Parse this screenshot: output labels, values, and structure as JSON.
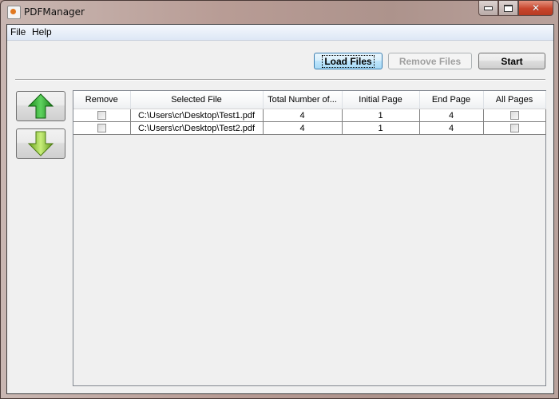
{
  "window": {
    "title": "PDFManager",
    "controls": {
      "minimize": "minimize-icon",
      "maximize": "maximize-icon",
      "close": "close-icon"
    }
  },
  "menubar": {
    "items": [
      {
        "label": "File"
      },
      {
        "label": "Help"
      }
    ]
  },
  "toolbar": {
    "load_label": "Load Files",
    "remove_label": "Remove Files",
    "start_label": "Start"
  },
  "side_buttons": {
    "up": "arrow-up-icon",
    "down": "arrow-down-icon"
  },
  "table": {
    "columns": [
      "Remove",
      "Selected File",
      "Total Number of...",
      "Initial Page",
      "End Page",
      "All Pages"
    ],
    "rows": [
      {
        "remove": false,
        "file": "C:\\Users\\cr\\Desktop\\Test1.pdf",
        "total": "4",
        "initial": "1",
        "end": "4",
        "all_pages": false
      },
      {
        "remove": false,
        "file": "C:\\Users\\cr\\Desktop\\Test2.pdf",
        "total": "4",
        "initial": "1",
        "end": "4",
        "all_pages": false
      }
    ]
  }
}
